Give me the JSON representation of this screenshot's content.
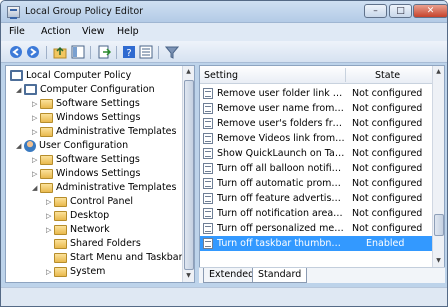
{
  "window": {
    "title": "Local Group Policy Editor",
    "controls": {
      "minimize": "–",
      "maximize": "□",
      "close": "✕"
    }
  },
  "menu": [
    "File",
    "Action",
    "View",
    "Help"
  ],
  "toolbar_icons": [
    "back-icon",
    "forward-icon",
    "up-folder-icon",
    "show-hide-tree-icon",
    "export-list-icon",
    "help-icon",
    "properties-icon",
    "filter-icon"
  ],
  "tree": {
    "root": "Local Computer Policy",
    "computer": "Computer Configuration",
    "computer_children": [
      "Software Settings",
      "Windows Settings",
      "Administrative Templates"
    ],
    "user": "User Configuration",
    "user_children": [
      "Software Settings",
      "Windows Settings",
      "Administrative Templates"
    ],
    "admin_children": [
      "Control Panel",
      "Desktop",
      "Network",
      "Shared Folders",
      "Start Menu and Taskbar",
      "System"
    ]
  },
  "list": {
    "col_setting": "Setting",
    "col_state": "State",
    "rows": [
      {
        "setting": "Remove user folder link fro...",
        "state": "Not configured"
      },
      {
        "setting": "Remove user name from Sta...",
        "state": "Not configured"
      },
      {
        "setting": "Remove user's folders from t...",
        "state": "Not configured"
      },
      {
        "setting": "Remove Videos link from Sta...",
        "state": "Not configured"
      },
      {
        "setting": "Show QuickLaunch on Task...",
        "state": "Not configured"
      },
      {
        "setting": "Turn off all balloon notificati...",
        "state": "Not configured"
      },
      {
        "setting": "Turn off automatic promoti...",
        "state": "Not configured"
      },
      {
        "setting": "Turn off feature advertiseme...",
        "state": "Not configured"
      },
      {
        "setting": "Turn off notification area cle...",
        "state": "Not configured"
      },
      {
        "setting": "Turn off personalized menus",
        "state": "Not configured"
      },
      {
        "setting": "Turn off taskbar thumbnails",
        "state": "Enabled"
      }
    ]
  },
  "tabs": [
    "Extended",
    "Standard"
  ],
  "colors": {
    "selection": "#3399ff",
    "frame": "#bdd3ea"
  }
}
